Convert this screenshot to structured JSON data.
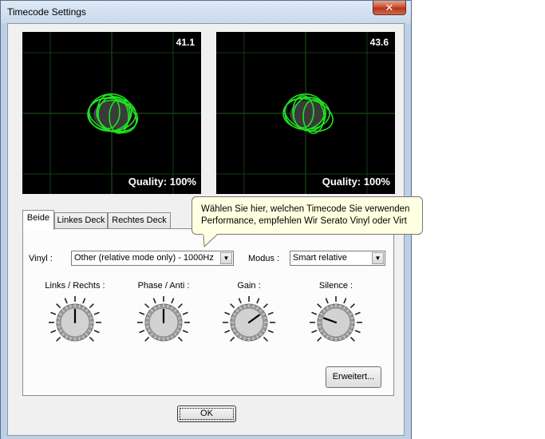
{
  "window": {
    "title": "Timecode Settings",
    "close_glyph": "✕"
  },
  "scopes": [
    {
      "value": "41.1",
      "quality": "Quality: 100%"
    },
    {
      "value": "43.6",
      "quality": "Quality: 100%"
    }
  ],
  "tabs": [
    "Beide",
    "Linkes Deck",
    "Rechtes Deck"
  ],
  "active_tab": "Beide",
  "tooltip": {
    "line1": "Wählen Sie hier, welchen Timecode Sie verwenden",
    "line2": "Performance, empfehlen Wir Serato Vinyl oder Virt"
  },
  "vinyl": {
    "label": "Vinyl :",
    "value": "Other (relative mode only) - 1000Hz"
  },
  "modus": {
    "label": "Modus :",
    "value": "Smart relative"
  },
  "knobs": [
    {
      "label": "Links / Rechts :",
      "value": 0.5
    },
    {
      "label": "Phase / Anti :",
      "value": 0.5
    },
    {
      "label": "Gain :",
      "value": 0.7
    },
    {
      "label": "Silence :",
      "value": 0.24
    }
  ],
  "buttons": {
    "advanced": "Erweitert...",
    "ok": "OK"
  },
  "colors": {
    "scope_trace": "#22e022",
    "scope_grid": "#1f5a1f",
    "tooltip_bg": "#ffffe1"
  }
}
